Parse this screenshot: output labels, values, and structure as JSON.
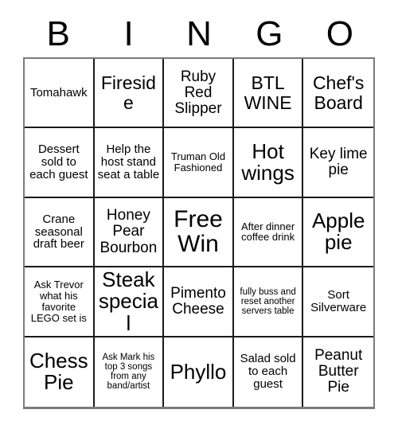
{
  "header": {
    "letters": [
      "B",
      "I",
      "N",
      "G",
      "O"
    ]
  },
  "grid": {
    "rows": 5,
    "columns": 5,
    "cells": [
      {
        "text": "Tomahawk",
        "size": "s-sm"
      },
      {
        "text": "Fireside",
        "size": "s-lg"
      },
      {
        "text": "Ruby Red Slipper",
        "size": "s-md"
      },
      {
        "text": "BTL WINE",
        "size": "s-lg"
      },
      {
        "text": "Chef's Board",
        "size": "s-lg"
      },
      {
        "text": "Dessert sold to each guest",
        "size": "s-sm"
      },
      {
        "text": "Help the host stand seat a table",
        "size": "s-sm"
      },
      {
        "text": "Truman Old Fashioned",
        "size": "s-xs"
      },
      {
        "text": "Hot wings",
        "size": "s-xl"
      },
      {
        "text": "Key lime pie",
        "size": "s-md"
      },
      {
        "text": "Crane seasonal draft beer",
        "size": "s-sm"
      },
      {
        "text": "Honey Pear Bourbon",
        "size": "s-md"
      },
      {
        "text": "Free Win",
        "size": "s-xxl"
      },
      {
        "text": "After dinner coffee drink",
        "size": "s-xs"
      },
      {
        "text": "Apple pie",
        "size": "s-xl"
      },
      {
        "text": "Ask Trevor what his favorite LEGO set is",
        "size": "s-xs"
      },
      {
        "text": "Steak special",
        "size": "s-xl"
      },
      {
        "text": "Pimento Cheese",
        "size": "s-md"
      },
      {
        "text": "fully buss and reset another servers table",
        "size": "s-xxs"
      },
      {
        "text": "Sort Silverware",
        "size": "s-sm"
      },
      {
        "text": "Chess Pie",
        "size": "s-xl"
      },
      {
        "text": "Ask Mark his top 3 songs from any band/artist",
        "size": "s-xxs"
      },
      {
        "text": "Phyllo",
        "size": "s-xl"
      },
      {
        "text": "Salad sold to each guest",
        "size": "s-sm"
      },
      {
        "text": "Peanut Butter Pie",
        "size": "s-md"
      }
    ]
  },
  "colors": {
    "grid_line": "#1a1a1a",
    "outer_border": "#7a7a7a",
    "background": "#ffffff",
    "text": "#000000"
  }
}
